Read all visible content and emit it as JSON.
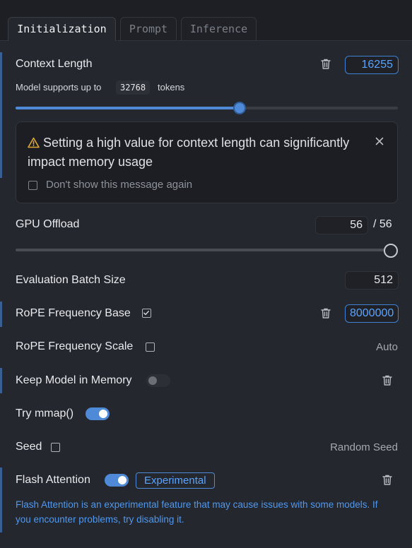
{
  "tabs": [
    {
      "label": "Initialization"
    },
    {
      "label": "Prompt"
    },
    {
      "label": "Inference"
    }
  ],
  "context_length": {
    "label": "Context Length",
    "value": "16255",
    "support_prefix": "Model supports up to",
    "max_tokens": "32768",
    "support_suffix": "tokens",
    "slider_fraction": 0.496
  },
  "warning": {
    "message": "Setting a high value for context length can significantly impact memory usage",
    "dont_show_label": "Don't show this message again",
    "dont_show_checked": false
  },
  "gpu_offload": {
    "label": "GPU Offload",
    "value": "56",
    "max": "/ 56",
    "slider_fraction": 1.0
  },
  "eval_batch": {
    "label": "Evaluation Batch Size",
    "value": "512"
  },
  "rope_base": {
    "label": "RoPE Frequency Base",
    "checked": true,
    "value": "8000000"
  },
  "rope_scale": {
    "label": "RoPE Frequency Scale",
    "checked": false,
    "value": "Auto"
  },
  "keep_in_memory": {
    "label": "Keep Model in Memory",
    "enabled": false
  },
  "mmap": {
    "label": "Try mmap()",
    "enabled": true
  },
  "seed": {
    "label": "Seed",
    "checked": false,
    "value": "Random Seed"
  },
  "flash_attention": {
    "label": "Flash Attention",
    "enabled": true,
    "badge": "Experimental",
    "note": "Flash Attention is an experimental feature that may cause issues with some models. If you encounter problems, try disabling it."
  },
  "colors": {
    "accent": "#4f8ad8",
    "accent_text": "#5aa4ff",
    "warning_icon": "#e0a72e",
    "panel": "#24272e"
  },
  "icons": {
    "trash": "trash-icon",
    "close": "close-icon",
    "warning": "warning-triangle-icon",
    "check": "checkmark-icon"
  }
}
